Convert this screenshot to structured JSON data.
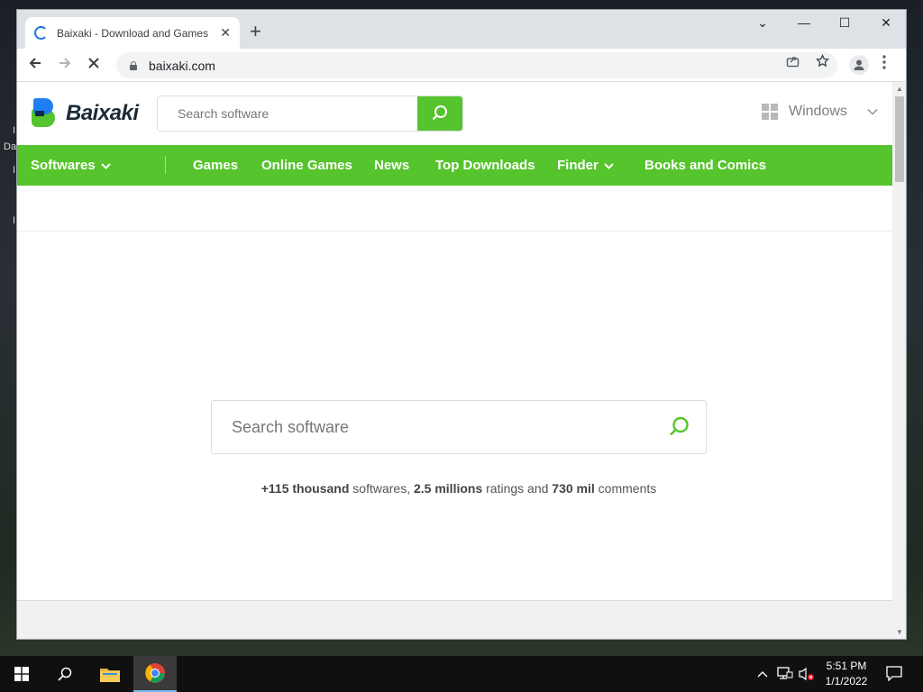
{
  "desktop": {
    "fragments": [
      "I",
      "Da",
      "I",
      "I"
    ]
  },
  "browser": {
    "tab": {
      "title": "Baixaki - Download and Games",
      "close": "✕"
    },
    "new_tab": "+",
    "controls": {
      "dropdown": "⌄",
      "minimize": "—",
      "maximize": "☐",
      "close": "✕"
    },
    "url": "baixaki.com"
  },
  "site": {
    "logo_text": "Baixaki",
    "header_search": {
      "placeholder": "Search software"
    },
    "os_selector": {
      "label": "Windows"
    },
    "nav": {
      "items": [
        "Softwares",
        "Games",
        "Online Games",
        "News",
        "Top Downloads",
        "Finder",
        "Books and Comics"
      ]
    },
    "main_search": {
      "placeholder": "Search software"
    },
    "stats": {
      "count_1": "+115 thousand",
      "text_1": " softwares, ",
      "count_2": "2.5 millions",
      "text_2": " ratings and ",
      "count_3": "730 mil",
      "text_3": " comments"
    },
    "brand_green": "#56c42c",
    "brand_blue": "#1e7ff0"
  },
  "taskbar": {
    "time": "5:51 PM",
    "date": "1/1/2022"
  }
}
